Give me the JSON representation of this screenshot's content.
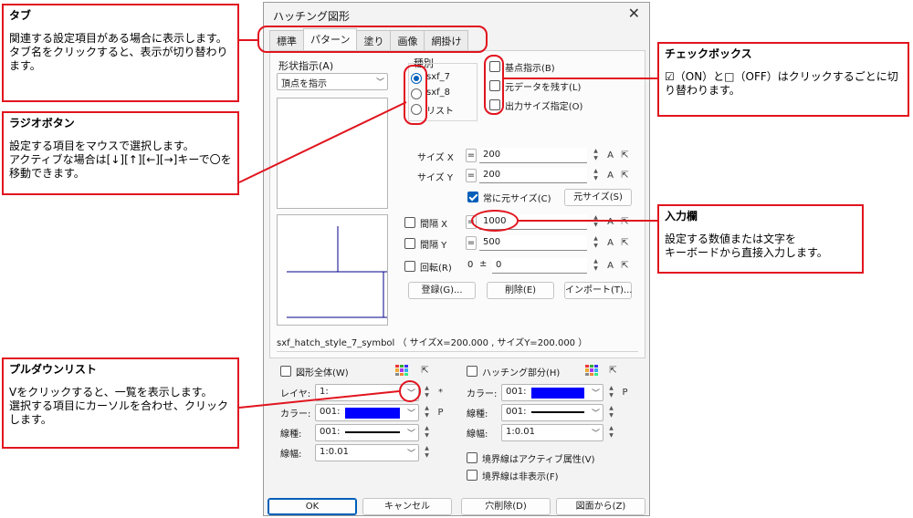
{
  "dialog": {
    "title": "ハッチング図形",
    "tabs": [
      "標準",
      "パターン",
      "塗り",
      "画像",
      "網掛け"
    ],
    "active_tab": 1,
    "shape_label": "形状指示(A)",
    "shape_value": "頂点を指示",
    "type_label": "種別",
    "radios": [
      "sxf_7",
      "sxf_8",
      "リスト"
    ],
    "checks": [
      "基点指示(B)",
      "元データを残す(L)",
      "出力サイズ指定(O)"
    ],
    "size_x_label": "サイズ X",
    "size_x": "200",
    "size_y_label": "サイズ Y",
    "size_y": "200",
    "always_orig_label": "常に元サイズ(C)",
    "orig_size_btn": "元サイズ(S)",
    "interval_x_label": "間隔 X",
    "interval_x": "1000",
    "interval_y_label": "間隔 Y",
    "interval_y": "500",
    "rotate_label": "回転(R)",
    "rotate_zero": "0",
    "rotate_pm": "±",
    "rotate_value": "0",
    "eq": "=",
    "a": "A",
    "register_btn": "登録(G)...",
    "delete_btn": "削除(E)",
    "import_btn": "インポート(T)...",
    "status": "sxf_hatch_style_7_symbol （ サイズX=200.000 , サイズY=200.000 ）",
    "whole_label": "図形全体(W)",
    "hatch_label": "ハッチング部分(H)",
    "layer_label": "レイヤ:",
    "layer_value": "1:",
    "color_label": "カラー:",
    "color_value": "001:",
    "linetype_label": "線種:",
    "linetype_value": "001:",
    "linewidth_label": "線幅:",
    "linewidth_value": "1:0.01",
    "star": "*",
    "p": "P",
    "border_active_label": "境界線はアクティブ属性(V)",
    "border_hidden_label": "境界線は非表示(F)",
    "ok_btn": "OK",
    "cancel_btn": "キャンセル",
    "hole_btn": "穴削除(D)",
    "from_fig_btn": "図面から(Z)",
    "accent_color": "#005fb8",
    "swatch_color": "#0000ff"
  },
  "callouts": {
    "tab": {
      "title": "タブ",
      "body": "関連する設定項目がある場合に表示します。\nタブ名をクリックすると、表示が切り替わります。"
    },
    "radio": {
      "title": "ラジオボタン",
      "body": "設定する項目をマウスで選択します。\nアクティブな場合は[↓][↑][←][→]キーで〇を移動できます。"
    },
    "pulldown": {
      "title": "プルダウンリスト",
      "body": "Vをクリックすると、一覧を表示します。\n選択する項目にカーソルを合わせ、クリックします。"
    },
    "checkbox": {
      "title": "チェックボックス",
      "body": "☑（ON）と□（OFF）はクリックするごとに切り替わります。"
    },
    "input": {
      "title": "入力欄",
      "body": "設定する数値または文字を\nキーボードから直接入力します。"
    }
  },
  "callout_color": "#e1141e"
}
